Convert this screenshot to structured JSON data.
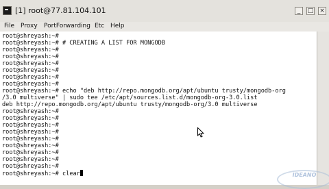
{
  "window": {
    "title": "[1] root@77.81.104.101",
    "minimize_glyph": "_",
    "maximize_glyph": "□",
    "close_glyph": "×"
  },
  "menu": {
    "items": [
      "File",
      "Proxy",
      "PortForwarding",
      "Etc",
      "Help"
    ]
  },
  "terminal": {
    "lines": [
      "root@shreyash:~#",
      "root@shreyash:~# # CREATING A LIST FOR MONGODB",
      "root@shreyash:~#",
      "root@shreyash:~#",
      "root@shreyash:~#",
      "root@shreyash:~#",
      "root@shreyash:~#",
      "root@shreyash:~#",
      "root@shreyash:~# echo \"deb http://repo.mongodb.org/apt/ubuntu trusty/mongodb-org",
      "/3.0 multiverse\" | sudo tee /etc/apt/sources.list.d/mongodb-org-3.0.list",
      "deb http://repo.mongodb.org/apt/ubuntu trusty/mongodb-org/3.0 multiverse",
      "root@shreyash:~#",
      "root@shreyash:~#",
      "root@shreyash:~#",
      "root@shreyash:~#",
      "root@shreyash:~#",
      "root@shreyash:~#",
      "root@shreyash:~#",
      "root@shreyash:~#",
      "root@shreyash:~#"
    ],
    "current_command_prompt": "root@shreyash:~# ",
    "current_command": "clear"
  },
  "watermark": {
    "text": "IDEANO"
  }
}
